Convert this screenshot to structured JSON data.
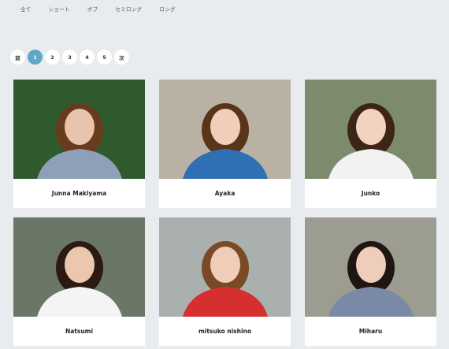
{
  "filters": [
    "全て",
    "ショート",
    "ボブ",
    "セミロング",
    "ロング"
  ],
  "pagination": {
    "prev": "前",
    "pages": [
      "1",
      "2",
      "3",
      "4",
      "5"
    ],
    "current": "1",
    "next": "次"
  },
  "profiles": [
    {
      "name": "Junna Makiyama",
      "bg": "#2f5a2e",
      "hair": "#6a3a1c",
      "top": "#8ea0b8",
      "skin": "#e8c4ad"
    },
    {
      "name": "Ayaka",
      "bg": "#b9b2a4",
      "hair": "#5a3418",
      "top": "#2f6fb3",
      "skin": "#efcfba"
    },
    {
      "name": "Junko",
      "bg": "#7b8b6c",
      "hair": "#3d2416",
      "top": "#f2f2f2",
      "skin": "#f2d2c0"
    },
    {
      "name": "Natsumi",
      "bg": "#6a7766",
      "hair": "#2b1a12",
      "top": "#f4f4f4",
      "skin": "#ecc6ad"
    },
    {
      "name": "mitsuko nishino",
      "bg": "#a9b0ae",
      "hair": "#7a4a26",
      "top": "#d62f2f",
      "skin": "#f0cdb9"
    },
    {
      "name": "Miharu",
      "bg": "#9c9d90",
      "hair": "#1f1612",
      "top": "#7a8aa6",
      "skin": "#efcdbb"
    }
  ]
}
